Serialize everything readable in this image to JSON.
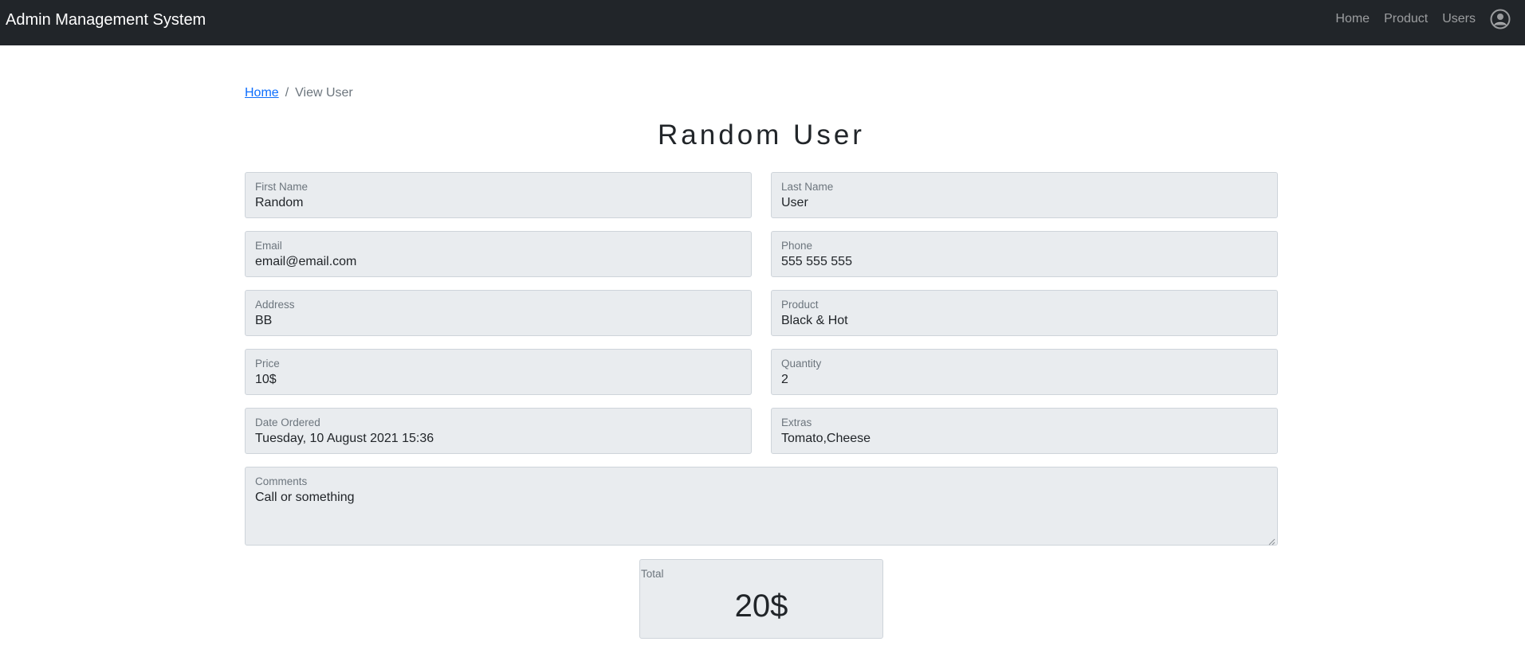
{
  "navbar": {
    "brand": "Admin Management System",
    "links": [
      "Home",
      "Product",
      "Users"
    ],
    "avatar_icon": "user-circle-icon"
  },
  "breadcrumb": {
    "home": "Home",
    "separator": "/",
    "current": "View User"
  },
  "page": {
    "title": "Random User"
  },
  "form": {
    "first_name": {
      "label": "First Name",
      "value": "Random"
    },
    "last_name": {
      "label": "Last Name",
      "value": "User"
    },
    "email": {
      "label": "Email",
      "value": "email@email.com"
    },
    "phone": {
      "label": "Phone",
      "value": "555 555 555"
    },
    "address": {
      "label": "Address",
      "value": "BB"
    },
    "product": {
      "label": "Product",
      "value": "Black & Hot"
    },
    "price": {
      "label": "Price",
      "value": "10$"
    },
    "quantity": {
      "label": "Quantity",
      "value": "2"
    },
    "date_ordered": {
      "label": "Date Ordered",
      "value": "Tuesday, 10 August 2021 15:36"
    },
    "extras": {
      "label": "Extras",
      "value": "Tomato,Cheese"
    },
    "comments": {
      "label": "Comments",
      "value": "Call or something"
    },
    "total": {
      "label": "Total",
      "value": "20$"
    }
  },
  "colors": {
    "navbar_bg": "#212529",
    "field_bg": "#e9ecef",
    "link": "#0d6efd"
  }
}
